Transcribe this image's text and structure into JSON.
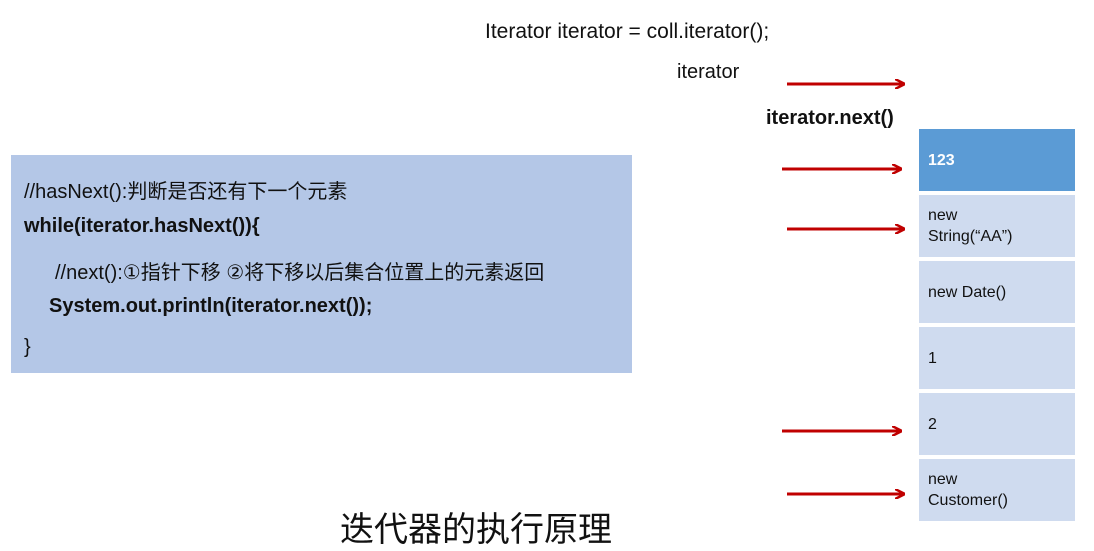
{
  "header": {
    "declaration": "Iterator iterator = coll.iterator();",
    "iterator_label": "iterator",
    "next_label": "iterator.next()"
  },
  "code": {
    "line0": "//hasNext():判断是否还有下一个元素",
    "line1": "while(iterator.hasNext()){",
    "line2": "//next():①指针下移 ②将下移以后集合位置上的元素返回",
    "line3": "System.out.println(iterator.next());",
    "line4": "}"
  },
  "collection": {
    "items": [
      "123",
      "new\nString(“AA”)",
      "new Date()",
      "1",
      "2",
      "new\nCustomer()"
    ]
  },
  "caption": "迭代器的执行原理",
  "colors": {
    "code_bg": "#b4c7e7",
    "cell_bg": "#cfdbef",
    "cell_highlight": "#5b9bd5",
    "arrow": "#c00000"
  }
}
